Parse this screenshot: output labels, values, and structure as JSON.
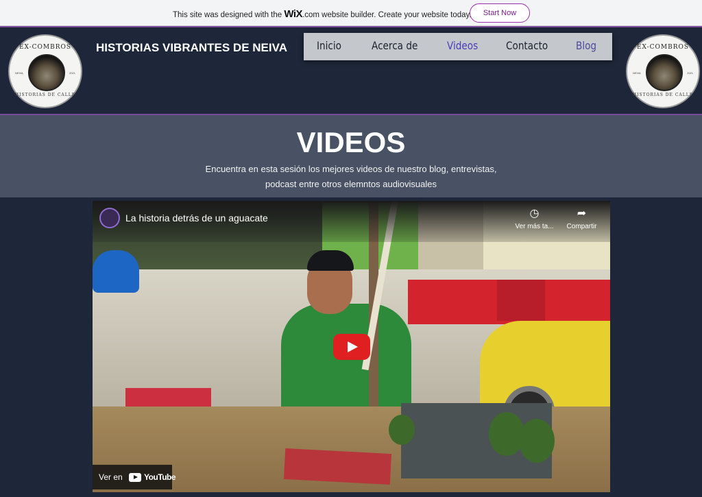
{
  "wix_banner": {
    "prefix": "This site was designed with the ",
    "brand": "WiX",
    "suffix": ".com website builder. Create your website today.",
    "start_button": "Start Now"
  },
  "header": {
    "title": "HISTORIAS VIBRANTES DE NEIVA",
    "logo": {
      "top_text": "EX-COMBROS",
      "bottom_text": "HISTORIAS DE CALLE",
      "left_text": "NEIVA",
      "right_text": "2021"
    },
    "nav": [
      {
        "label": "Inicio",
        "active": false
      },
      {
        "label": "Acerca de",
        "active": false
      },
      {
        "label": "Videos",
        "active": true
      },
      {
        "label": "Contacto",
        "active": false
      },
      {
        "label": "Blog",
        "active": false
      }
    ]
  },
  "hero": {
    "title": "VIDEOS",
    "subtitle_line1": "Encuentra en esta sesión los mejores videos de nuestro blog, entrevistas,",
    "subtitle_line2": "podcast entre otros elemntos audiovisuales"
  },
  "video": {
    "title": "La historia detrás de un aguacate",
    "watch_later": "Ver más ta...",
    "share": "Compartir",
    "watch_on": "Ver en",
    "youtube": "YouTube"
  },
  "colors": {
    "page_bg": "#1e2739",
    "hero_bg": "#485264",
    "nav_bg": "#c4c8cc",
    "nav_active": "#4a3db8",
    "header_border": "#7a4a9a",
    "play_button": "#e02020"
  }
}
